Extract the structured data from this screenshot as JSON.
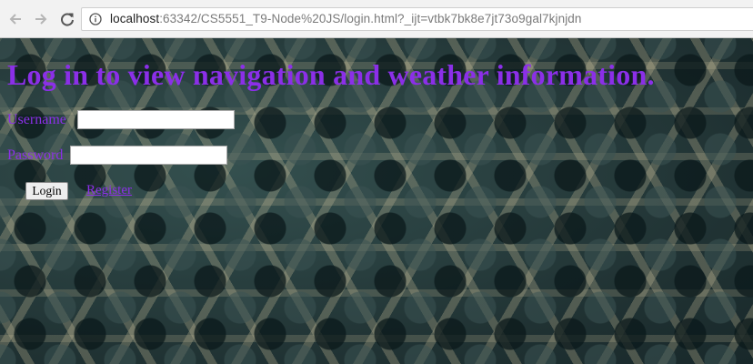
{
  "browser": {
    "url_host": "localhost",
    "url_rest": ":63342/CS5551_T9-Node%20JS/login.html?_ijt=vtbk7bk8e7jt73o9gal7kjnjdn",
    "icons": {
      "back": "arrow-left-icon",
      "forward": "arrow-right-icon",
      "reload": "reload-icon",
      "info": "info-icon"
    }
  },
  "page": {
    "heading": "Log in to view navigation and weather information.",
    "username_label": "Username",
    "username_value": "",
    "password_label": "Password",
    "password_value": "",
    "login_button": "Login",
    "register_link": "Register"
  },
  "colors": {
    "accent": "#8b2fe8",
    "background": "#2b4142"
  }
}
